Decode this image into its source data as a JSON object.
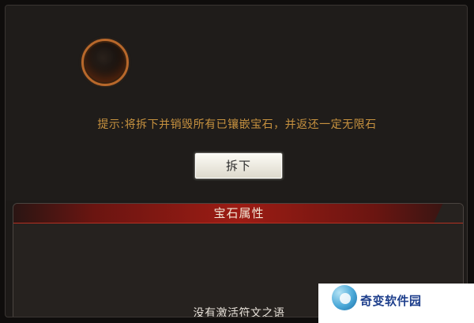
{
  "dialog": {
    "tip": "提示:将拆下并销毁所有已镶嵌宝石，并返还一定无限石",
    "remove_button_label": "拆下"
  },
  "gem_attributes": {
    "title": "宝石属性",
    "empty_text": "没有激活符文之语"
  },
  "watermark": {
    "text": "奇变软件园"
  },
  "colors": {
    "tip": "#c6913f",
    "header_red": "#9c1c14",
    "socket_ring": "#b8682b"
  }
}
